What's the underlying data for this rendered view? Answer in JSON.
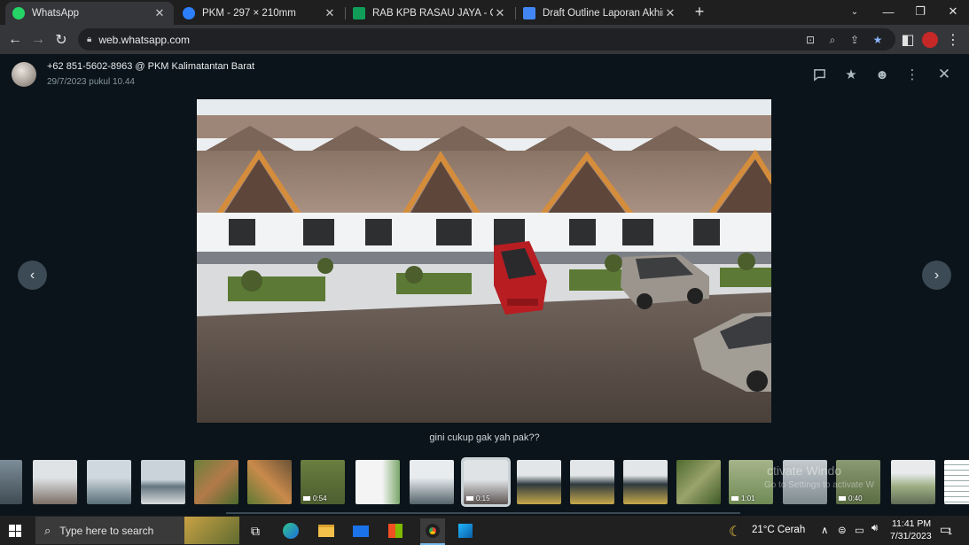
{
  "browser": {
    "tabs": [
      {
        "title": "WhatsApp",
        "icon": "whatsapp-icon",
        "color": "#25d366",
        "active": true
      },
      {
        "title": "PKM - 297 × 210mm",
        "icon": "canva-icon",
        "color": "#2d7ff9",
        "active": false
      },
      {
        "title": "RAB KPB RASAU JAYA - Google Sh",
        "icon": "sheets-icon",
        "color": "#0f9d58",
        "active": false
      },
      {
        "title": "Draft Outline Laporan Akhir -edit",
        "icon": "docs-icon",
        "color": "#4285f4",
        "active": false
      }
    ],
    "new_tab": "+",
    "url": "web.whatsapp.com"
  },
  "viewer": {
    "sender": "+62 851-5602-8963 @ PKM Kalimatantan Barat",
    "timestamp": "29/7/2023 pukul 10.44",
    "caption": "gini cukup gak yah pak??",
    "prev_arrow": "‹",
    "next_arrow": "›",
    "header_icons": [
      "reply-icon",
      "star-icon",
      "emoji-icon",
      "more-icon",
      "close-icon"
    ]
  },
  "thumbnails": [
    {
      "kind": "render",
      "duration": ""
    },
    {
      "kind": "render",
      "duration": ""
    },
    {
      "kind": "render",
      "duration": ""
    },
    {
      "kind": "render",
      "duration": ""
    },
    {
      "kind": "map",
      "duration": ""
    },
    {
      "kind": "map",
      "duration": ""
    },
    {
      "kind": "video",
      "duration": "0:54"
    },
    {
      "kind": "plan",
      "duration": ""
    },
    {
      "kind": "render",
      "duration": ""
    },
    {
      "kind": "video",
      "duration": "0:15"
    },
    {
      "kind": "photo",
      "duration": ""
    },
    {
      "kind": "photo",
      "duration": ""
    },
    {
      "kind": "photo",
      "duration": ""
    },
    {
      "kind": "map",
      "duration": ""
    },
    {
      "kind": "video",
      "duration": "1:01"
    },
    {
      "kind": "video",
      "duration": ""
    },
    {
      "kind": "video",
      "duration": "0:40"
    },
    {
      "kind": "photo",
      "duration": ""
    },
    {
      "kind": "document",
      "duration": ""
    }
  ],
  "activation_watermark": {
    "line1": "ctivate Windo",
    "line2": "Go to Settings to activate W"
  },
  "taskbar": {
    "search_placeholder": "Type here to search",
    "weather": "21°C  Cerah",
    "time": "11:41 PM",
    "date": "7/31/2023",
    "notification_count": "1"
  }
}
